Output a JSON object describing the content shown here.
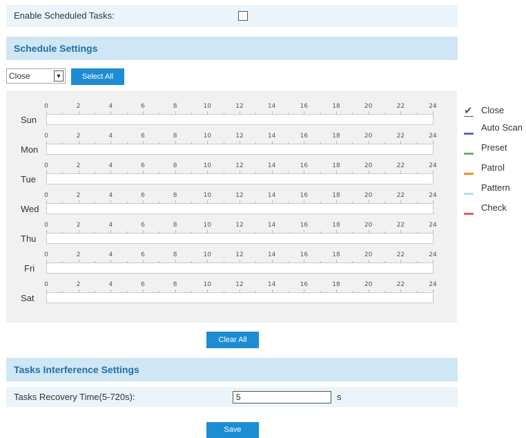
{
  "enable_scheduled_tasks": {
    "label": "Enable Scheduled Tasks:",
    "checked": false
  },
  "schedule_settings": {
    "title": "Schedule Settings",
    "mode_select": {
      "value": "Close"
    },
    "select_all_label": "Select All",
    "clear_all_label": "Clear All",
    "days": [
      {
        "label": "Sun"
      },
      {
        "label": "Mon"
      },
      {
        "label": "Tue"
      },
      {
        "label": "Wed"
      },
      {
        "label": "Thu"
      },
      {
        "label": "Fri"
      },
      {
        "label": "Sat"
      }
    ],
    "hour_labels": [
      "0",
      "2",
      "4",
      "6",
      "8",
      "10",
      "12",
      "14",
      "16",
      "18",
      "20",
      "22",
      "24"
    ]
  },
  "legend": [
    {
      "label": "Close",
      "icon": "checkmark-icon",
      "color": "#555555"
    },
    {
      "label": "Auto Scan",
      "color": "#5a6ab5"
    },
    {
      "label": "Preset",
      "color": "#6fb06f"
    },
    {
      "label": "Patrol",
      "color": "#f08c1e"
    },
    {
      "label": "Pattern",
      "color": "#b6ddf2"
    },
    {
      "label": "Check",
      "color": "#e85a67"
    }
  ],
  "tasks_interference": {
    "title": "Tasks Interference Settings",
    "recovery_label": "Tasks Recovery Time(5-720s):",
    "recovery_value": "5",
    "unit": "s"
  },
  "save_label": "Save",
  "colors": {
    "accent": "#1e8cd2",
    "header_bg": "#cfe6f4",
    "header_text": "#1f6fa8",
    "row_bg": "#eaf4fa"
  }
}
